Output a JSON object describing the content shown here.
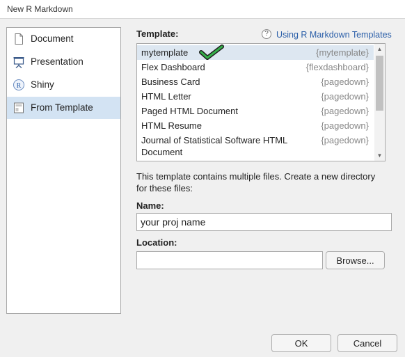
{
  "window": {
    "title": "New R Markdown"
  },
  "sidebar": {
    "items": [
      {
        "label": "Document",
        "icon": "document-icon"
      },
      {
        "label": "Presentation",
        "icon": "presentation-icon"
      },
      {
        "label": "Shiny",
        "icon": "shiny-icon"
      },
      {
        "label": "From Template",
        "icon": "template-icon",
        "selected": true
      }
    ]
  },
  "template_section": {
    "label": "Template:",
    "help_link": "Using R Markdown Templates",
    "help_icon_glyph": "?"
  },
  "templates": [
    {
      "name": "mytemplate",
      "package": "{mytemplate}",
      "selected": true
    },
    {
      "name": "Flex Dashboard",
      "package": "{flexdashboard}"
    },
    {
      "name": "Business Card",
      "package": "{pagedown}"
    },
    {
      "name": "HTML Letter",
      "package": "{pagedown}"
    },
    {
      "name": "Paged HTML Document",
      "package": "{pagedown}"
    },
    {
      "name": "HTML Resume",
      "package": "{pagedown}"
    },
    {
      "name": "Journal of Statistical Software HTML Document",
      "package": "{pagedown}"
    }
  ],
  "scroll_glyphs": {
    "up": "▲",
    "down": "▼"
  },
  "description": "This template contains multiple files. Create a new directory for these files:",
  "name_field": {
    "label": "Name:",
    "value": "your proj name"
  },
  "location_field": {
    "label": "Location:",
    "value": ""
  },
  "buttons": {
    "browse": "Browse...",
    "ok": "OK",
    "cancel": "Cancel"
  },
  "colors": {
    "selected_sidebar": "#d3e3f3",
    "checkmark": "#35b04a",
    "link": "#2a5ea8"
  }
}
